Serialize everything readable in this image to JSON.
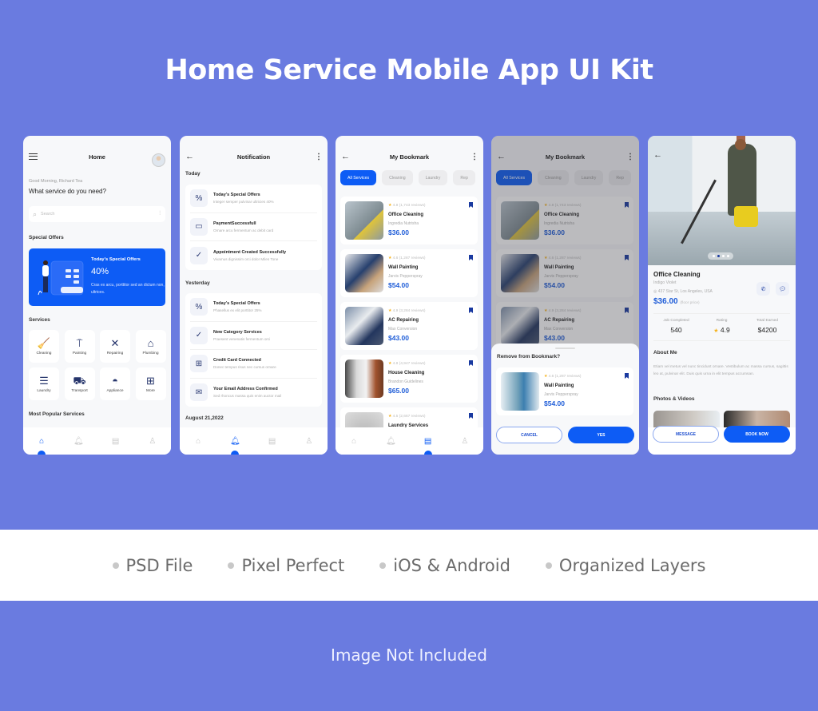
{
  "header": {
    "title": "Home Service Mobile App UI Kit"
  },
  "features": [
    "PSD File",
    "Pixel Perfect",
    "iOS & Android",
    "Organized Layers"
  ],
  "footer_note": "Image Not Included",
  "colors": {
    "background": "#6a7be0",
    "accent": "#0d5cf5",
    "icon_dark": "#25346b",
    "star": "#f5b21b"
  },
  "home": {
    "title": "Home",
    "greeting": "Good Morning, Richard Tea",
    "question": "What service do you need?",
    "search_placeholder": "Search",
    "special_offers_label": "Special Offers",
    "offer": {
      "title": "Today's Special Offers",
      "discount": "40%",
      "text": "Cras ex arcu, porttitor sed an dictum non, ultrices."
    },
    "services_label": "Services",
    "services": [
      {
        "label": "Cleaning",
        "icon": "cleaning-icon"
      },
      {
        "label": "Painting",
        "icon": "paint-roller-icon"
      },
      {
        "label": "Repairing",
        "icon": "tools-icon"
      },
      {
        "label": "Plumbing",
        "icon": "house-icon"
      },
      {
        "label": "Laundry",
        "icon": "laundry-basket-icon"
      },
      {
        "label": "Transport",
        "icon": "truck-icon"
      },
      {
        "label": "Appliance",
        "icon": "appliance-icon"
      },
      {
        "label": "More",
        "icon": "grid-icon"
      }
    ],
    "popular_label": "Most Popular Services"
  },
  "notification": {
    "title": "Notification",
    "today_label": "Today",
    "today": [
      {
        "title": "Today's Special Offers",
        "subtitle": "Integer semper pulvinar ultricies 40%",
        "icon": "percent-icon"
      },
      {
        "title": "PaymentSuccessfull",
        "subtitle": "Ornare arcu fermentum ac debit card",
        "icon": "card-icon"
      },
      {
        "title": "Appointment Created Successfully",
        "subtitle": "Vivamus dignissim orci dolor Miles Tone",
        "icon": "check-circle-icon"
      }
    ],
    "yesterday_label": "Yesterday",
    "yesterday": [
      {
        "title": "Today's Special Offers",
        "subtitle": "Phasellus ex elit porttitor 25%",
        "icon": "percent-icon"
      },
      {
        "title": "New Category Services",
        "subtitle": "Praesent venenatis fermentum orci",
        "icon": "check-circle-icon"
      },
      {
        "title": "Credit Card Connected",
        "subtitle": "Donec tempus risus nec cursus ornare",
        "icon": "grid-icon"
      },
      {
        "title": "Your Email Address Confirmed",
        "subtitle": "Sed rhoncus massa quis enim auctor mail",
        "icon": "mail-icon"
      }
    ],
    "date_label": "August 21,2022"
  },
  "bookmark": {
    "title": "My Bookmark",
    "chips": [
      "All Services",
      "Cleaning",
      "Laundry",
      "Rep"
    ],
    "items": [
      {
        "rating": "4.8",
        "reviews": "(1,743 reviews)",
        "name": "Office Cleaning",
        "provider": "Ingredia Nutrisha",
        "price": "$36.00"
      },
      {
        "rating": "4.6",
        "reviews": "(1,287 reviews)",
        "name": "Wall Painting",
        "provider": "Jarvis Pepperspray",
        "price": "$54.00"
      },
      {
        "rating": "4.9",
        "reviews": "(3,284 reviews)",
        "name": "AC Repairing",
        "provider": "Max Conversion",
        "price": "$43.00"
      },
      {
        "rating": "4.8",
        "reviews": "(4,947 reviews)",
        "name": "House Cleaning",
        "provider": "Brandon Guidelines",
        "price": "$65.00"
      },
      {
        "rating": "4.5",
        "reviews": "(2,667 reviews)",
        "name": "Laundry Services",
        "provider": "",
        "price": ""
      }
    ]
  },
  "remove_dialog": {
    "title": "Remove from Bookmark?",
    "item": {
      "rating": "4.6",
      "reviews": "(1,287 reviews)",
      "name": "Wall Painting",
      "provider": "Jarvis Pepperspray",
      "price": "$54.00"
    },
    "cancel_label": "CANCEL",
    "confirm_label": "YES"
  },
  "detail": {
    "title": "Office Cleaning",
    "provider": "Indigo Violet",
    "address": "437 Star St, Los Angeles, USA",
    "price": "$36.00",
    "price_note": "(floor price)",
    "stats": [
      {
        "label": "Job Completed",
        "value": "540"
      },
      {
        "label": "Rating",
        "value": "4.9"
      },
      {
        "label": "Total Earned",
        "value": "$4200"
      }
    ],
    "about_label": "About Me",
    "about_text": "Etiam vel metus vel nunc tincidunt ornare. Vestibulum ac massa cursus, sagittis leo at, pulvinar elit. Duis quis urna in elit tempus accumsan.",
    "photos_label": "Photos & Videos",
    "message_label": "MESSAGE",
    "book_label": "BOOK NOW"
  }
}
